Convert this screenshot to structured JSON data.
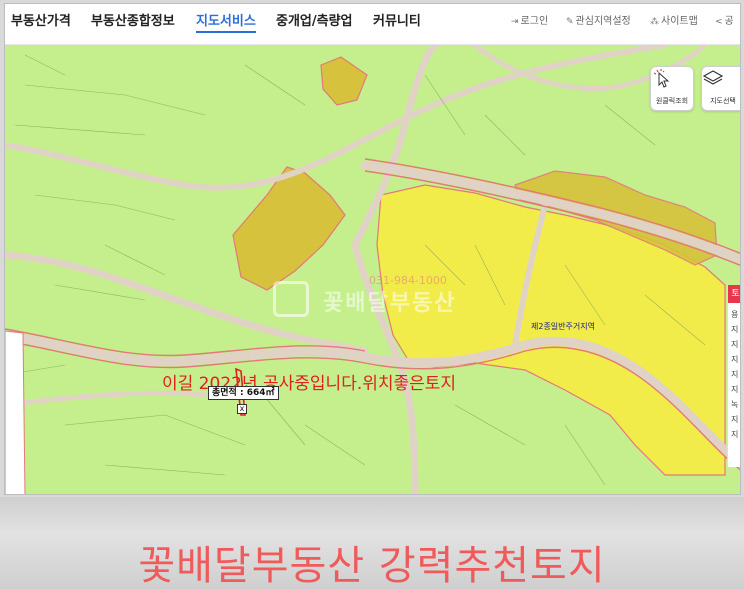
{
  "nav": {
    "items": [
      {
        "label": "부동산가격"
      },
      {
        "label": "부동산종합정보"
      },
      {
        "label": "지도서비스",
        "active": true
      },
      {
        "label": "중개업/측량업"
      },
      {
        "label": "커뮤니티"
      }
    ],
    "util": [
      {
        "label": "로그인",
        "icon": "login-icon"
      },
      {
        "label": "관심지역설정",
        "icon": "pin-icon"
      },
      {
        "label": "사이트맵",
        "icon": "sitemap-icon"
      },
      {
        "label": "공",
        "icon": "share-icon"
      }
    ]
  },
  "map": {
    "controls": [
      {
        "label": "원클릭조회",
        "icon": "cursor-click-icon"
      },
      {
        "label": "지도선택",
        "icon": "layers-icon"
      }
    ],
    "zone_label": "제2종일반주거지역",
    "watermark_phone": "031-984-1000",
    "watermark_brand": "꽃배달부동산",
    "note": "이길 2022년 공사중입니다.위치좋은토지",
    "area_tag": "총면적 : 664㎡",
    "close_symbol": "x",
    "side_panel": {
      "tab": "토",
      "letters": [
        "용",
        "지",
        "지",
        "지",
        "지",
        "지",
        "녹",
        "지",
        "지"
      ]
    },
    "colors": {
      "green_zone": "#c5ef8c",
      "yellow_zone": "#f2ec4a",
      "olive_zone": "#d6c23c",
      "road": "#e0d3c6",
      "boundary": "#e4787a"
    }
  },
  "banner": {
    "text": "꽃배달부동산 강력추천토지"
  }
}
